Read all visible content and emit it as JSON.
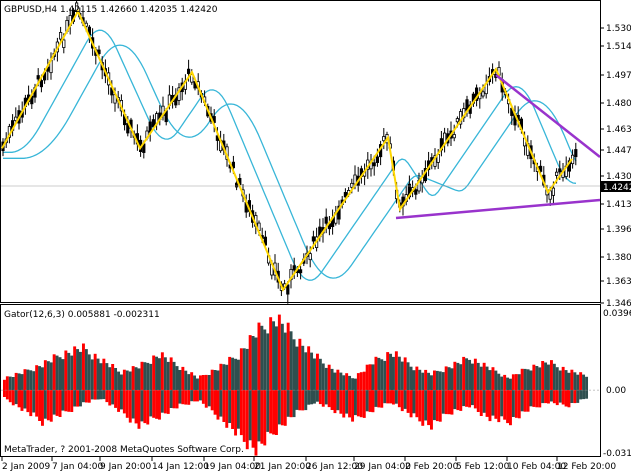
{
  "window": {
    "header": "GBPUSD,H4  1.42115 1.42660 1.42035 1.42420",
    "gator_header": "Gator(12,6,3) 0.005881 -0.002311",
    "copyright": "MetaTrader, ? 2001-2008 MetaQuotes Software Corp."
  },
  "price_scale": [
    "1.53060",
    "1.51450",
    "1.49710",
    "1.48060",
    "1.46360",
    "1.44710",
    "1.43010",
    "1.41360",
    "1.39660",
    "1.38010",
    "1.36310",
    "1.34660"
  ],
  "current_price": "1.42420",
  "gator_scale": {
    "top": "0.039629",
    "zero": "0.00",
    "bottom": "-0.031612"
  },
  "time_labels": [
    "2 Jan 2009",
    "7 Jan 04:00",
    "9 Jan 20:00",
    "14 Jan 12:00",
    "19 Jan 04:00",
    "21 Jan 20:00",
    "26 Jan 12:00",
    "29 Jan 04:00",
    "2 Feb 20:00",
    "5 Feb 12:00",
    "10 Feb 04:00",
    "12 Feb 20:00"
  ],
  "colors": {
    "candle": "#000000",
    "zigzag": "#ffd700",
    "ma": "#38b6d8",
    "trendline": "#9933cc",
    "gator_up": "#ff0000",
    "gator_down": "#2f4f4f",
    "grid": "#000000"
  },
  "chart_data": [
    {
      "type": "candlestick",
      "title": "GBPUSD,H4",
      "ylim": [
        1.3466,
        1.5306
      ],
      "zigzag": [
        {
          "x": "2 Jan 2009",
          "y": 1.445
        },
        {
          "x": "7 Jan",
          "y": 1.535
        },
        {
          "x": "9 Jan",
          "y": 1.445
        },
        {
          "x": "14 Jan",
          "y": 1.495
        },
        {
          "x": "21 Jan",
          "y": 1.352
        },
        {
          "x": "29 Jan",
          "y": 1.452
        },
        {
          "x": "2 Feb",
          "y": 1.405
        },
        {
          "x": "5 Feb",
          "y": 1.497
        },
        {
          "x": "10 Feb",
          "y": 1.416
        },
        {
          "x": "12 Feb",
          "y": 1.438
        }
      ],
      "last_close": 1.4242
    },
    {
      "type": "bar",
      "title": "Gator(12,6,3)",
      "ylim": [
        -0.031612,
        0.039629
      ],
      "series": [
        {
          "name": "upper",
          "values": [
            0.006,
            0.009,
            0.013,
            0.018,
            0.021,
            0.015,
            0.009,
            0.012,
            0.018,
            0.012,
            0.006,
            0.011,
            0.017,
            0.029,
            0.036,
            0.026,
            0.017,
            0.01,
            0.006,
            0.014,
            0.019,
            0.012,
            0.008,
            0.012,
            0.016,
            0.011,
            0.006,
            0.011,
            0.014,
            0.01,
            0.007
          ]
        },
        {
          "name": "lower",
          "values": [
            -0.004,
            -0.01,
            -0.016,
            -0.012,
            -0.007,
            -0.004,
            -0.011,
            -0.018,
            -0.013,
            -0.008,
            -0.005,
            -0.013,
            -0.022,
            -0.03,
            -0.02,
            -0.012,
            -0.006,
            -0.01,
            -0.015,
            -0.01,
            -0.006,
            -0.013,
            -0.018,
            -0.011,
            -0.008,
            -0.014,
            -0.016,
            -0.01,
            -0.006,
            -0.008,
            -0.004
          ]
        }
      ]
    }
  ]
}
